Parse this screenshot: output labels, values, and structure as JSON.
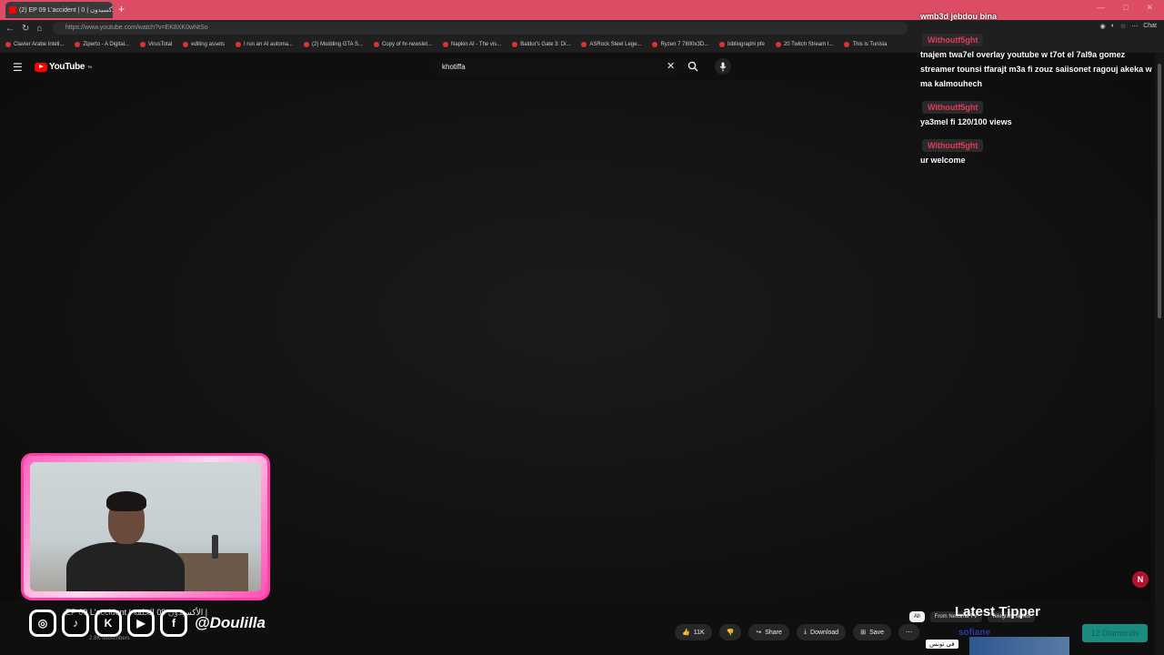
{
  "browser": {
    "tab_title": "(2) EP 09 L'accident | الأكسيدون | 0",
    "tab_close": "×",
    "new_tab": "+",
    "url": "https://www.youtube.com/watch?v=EK8XK0wNtSo",
    "window_controls": [
      "—",
      "□",
      "✕"
    ],
    "bookmarks": [
      "Clavier Arabe Intell...",
      "Ziperto - A Digital...",
      "VirusTotal",
      "editing assets",
      "I run an AI automa...",
      "(2) Modding GTA S...",
      "Copy of hr-newslet...",
      "Napkin AI - The vis...",
      "Baldur's Gate 3: Di...",
      "ASRock Steel Lege...",
      "Ryzen 7 7800x3D...",
      "bibliographi pfe",
      "20 Twitch Stream I...",
      "This is Tunisia"
    ],
    "extensions_label": "Chat"
  },
  "youtube": {
    "logo_text": "YouTube",
    "logo_sup": "TN",
    "search_value": "khotiffa"
  },
  "chat": {
    "messages": [
      {
        "user": "",
        "text": "wmb3d jebdou bina"
      },
      {
        "user": "Withoutf5ght",
        "text": "tnajem twa7el overlay youtube w t7ot el 7al9a gomez streamer tounsi tfarajt m3a fi zouz saiisonet ragouj akeka w ma kalmouhech"
      },
      {
        "user": "Withoutf5ght",
        "text": "ya3mel fi 120/100 views"
      },
      {
        "user": "Withoutf5ght",
        "text": "ur welcome"
      }
    ]
  },
  "video": {
    "title_partial": "EP 09 L'accident | الأكسيدون 09 الحلقة |",
    "subscribers": "2.8K subscribers",
    "handle": "@Doulilla",
    "actions": {
      "like_count": "11K",
      "share": "Share",
      "download": "Download",
      "save": "Save",
      "more": "⋯"
    },
    "filters": [
      "All",
      "From Nessma TV",
      "Telegram series"
    ]
  },
  "overlay": {
    "latest_tipper_label": "Latest Tipper",
    "tipper_name": "sofiane",
    "tip_amount": "12 Diamonds",
    "arabic_tag": "في تونس",
    "badge": "N"
  }
}
